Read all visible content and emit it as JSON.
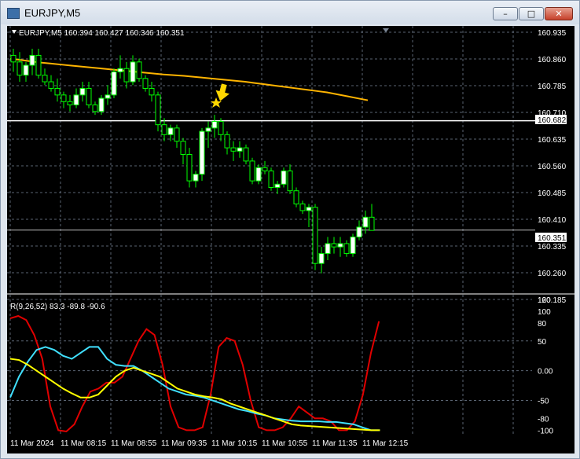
{
  "window": {
    "title": "EURJPY,M5",
    "minimize": "–",
    "maximize": "□",
    "close": "✕"
  },
  "chart_header": "EURJPY,M5  160.394 160.427 160.346 160.351",
  "indicator_header": "R(9,26,52) 83.3 -89.8 -90.6",
  "colors": {
    "bg": "#000000",
    "bull": "#ffffff",
    "bear": "#000000",
    "wick": "#00ff00",
    "ma": "#ffb400",
    "red": "#e00000",
    "cyan": "#40e0ff",
    "yellow": "#ffff00",
    "arrow": "#ffd700"
  },
  "price_axis": [
    "160.935",
    "160.860",
    "160.785",
    "160.710",
    "160.635",
    "160.560",
    "160.485",
    "160.410",
    "160.335",
    "160.260",
    "160.185"
  ],
  "price_tags": [
    "160.682",
    "160.351"
  ],
  "indicator_axis": [
    "120",
    "100",
    "80",
    "50",
    "0.00",
    "-50",
    "-80",
    "-100"
  ],
  "time_axis": [
    "11 Mar 2024",
    "11 Mar 08:15",
    "11 Mar 08:55",
    "11 Mar 09:35",
    "11 Mar 10:15",
    "11 Mar 10:55",
    "11 Mar 11:35",
    "11 Mar 12:15"
  ],
  "chart_data": {
    "type": "candlestick",
    "symbol": "EURJPY",
    "timeframe": "M5",
    "ylim": [
      160.16,
      160.95
    ],
    "horizontal_lines": [
      160.682,
      160.351
    ],
    "candles": [
      [
        160.88,
        160.9,
        160.83,
        160.86
      ],
      [
        160.86,
        160.89,
        160.8,
        160.82
      ],
      [
        160.82,
        160.86,
        160.8,
        160.85
      ],
      [
        160.85,
        160.9,
        160.82,
        160.88
      ],
      [
        160.88,
        160.9,
        160.81,
        160.82
      ],
      [
        160.82,
        160.84,
        160.79,
        160.8
      ],
      [
        160.8,
        160.82,
        160.77,
        160.78
      ],
      [
        160.78,
        160.81,
        160.74,
        160.76
      ],
      [
        160.76,
        160.77,
        160.72,
        160.74
      ],
      [
        160.74,
        160.76,
        160.71,
        160.73
      ],
      [
        160.73,
        160.78,
        160.72,
        160.76
      ],
      [
        160.76,
        160.8,
        160.74,
        160.78
      ],
      [
        160.78,
        160.8,
        160.72,
        160.73
      ],
      [
        160.73,
        160.74,
        160.7,
        160.71
      ],
      [
        160.71,
        160.76,
        160.7,
        160.75
      ],
      [
        160.75,
        160.79,
        160.73,
        160.76
      ],
      [
        160.76,
        160.84,
        160.75,
        160.83
      ],
      [
        160.83,
        160.88,
        160.81,
        160.84
      ],
      [
        160.84,
        160.86,
        160.78,
        160.8
      ],
      [
        160.8,
        160.88,
        160.79,
        160.86
      ],
      [
        160.86,
        160.87,
        160.8,
        160.81
      ],
      [
        160.81,
        160.82,
        160.77,
        160.78
      ],
      [
        160.78,
        160.8,
        160.74,
        160.76
      ],
      [
        160.76,
        160.77,
        160.65,
        160.67
      ],
      [
        160.67,
        160.69,
        160.62,
        160.64
      ],
      [
        160.64,
        160.67,
        160.62,
        160.66
      ],
      [
        160.66,
        160.67,
        160.6,
        160.62
      ],
      [
        160.62,
        160.63,
        160.55,
        160.58
      ],
      [
        160.58,
        160.6,
        160.48,
        160.5
      ],
      [
        160.5,
        160.53,
        160.48,
        160.52
      ],
      [
        160.52,
        160.66,
        160.5,
        160.65
      ],
      [
        160.65,
        160.68,
        160.6,
        160.66
      ],
      [
        160.66,
        160.7,
        160.63,
        160.68
      ],
      [
        160.68,
        160.69,
        160.62,
        160.64
      ],
      [
        160.64,
        160.65,
        160.58,
        160.6
      ],
      [
        160.6,
        160.62,
        160.56,
        160.59
      ],
      [
        160.59,
        160.62,
        160.57,
        160.6
      ],
      [
        160.6,
        160.61,
        160.55,
        160.56
      ],
      [
        160.56,
        160.57,
        160.49,
        160.5
      ],
      [
        160.5,
        160.55,
        160.49,
        160.54
      ],
      [
        160.54,
        160.56,
        160.52,
        160.53
      ],
      [
        160.53,
        160.54,
        160.47,
        160.48
      ],
      [
        160.48,
        160.5,
        160.46,
        160.49
      ],
      [
        160.49,
        160.54,
        160.48,
        160.53
      ],
      [
        160.53,
        160.55,
        160.46,
        160.47
      ],
      [
        160.47,
        160.48,
        160.42,
        160.43
      ],
      [
        160.43,
        160.44,
        160.4,
        160.41
      ],
      [
        160.41,
        160.43,
        160.36,
        160.42
      ],
      [
        160.42,
        160.43,
        160.23,
        160.25
      ],
      [
        160.25,
        160.3,
        160.22,
        160.28
      ],
      [
        160.28,
        160.33,
        160.26,
        160.31
      ],
      [
        160.31,
        160.33,
        160.28,
        160.3
      ],
      [
        160.3,
        160.33,
        160.27,
        160.31
      ],
      [
        160.31,
        160.32,
        160.27,
        160.28
      ],
      [
        160.28,
        160.34,
        160.27,
        160.33
      ],
      [
        160.33,
        160.38,
        160.32,
        160.36
      ],
      [
        160.36,
        160.41,
        160.34,
        160.39
      ],
      [
        160.39,
        160.43,
        160.35,
        160.35
      ]
    ],
    "moving_average": [
      160.87,
      160.866,
      160.862,
      160.858,
      160.855,
      160.852,
      160.849,
      160.846,
      160.843,
      160.84,
      160.837,
      160.834,
      160.831,
      160.828,
      160.825,
      160.822,
      160.82,
      160.818,
      160.815,
      160.812,
      160.809,
      160.806,
      160.803,
      160.8,
      160.796,
      160.792,
      160.788,
      160.784,
      160.78,
      160.776,
      160.772,
      160.768,
      160.762,
      160.756,
      160.75,
      160.744
    ],
    "indicator": {
      "ylim": [
        -110,
        125
      ],
      "red": [
        88,
        92,
        85,
        60,
        20,
        -60,
        -100,
        -102,
        -90,
        -60,
        -35,
        -30,
        -20,
        -20,
        -10,
        20,
        50,
        70,
        60,
        10,
        -60,
        -95,
        -100,
        -100,
        -95,
        -40,
        40,
        55,
        50,
        10,
        -50,
        -95,
        -100,
        -100,
        -95,
        -80,
        -60,
        -70,
        -80,
        -80,
        -85,
        -100,
        -100,
        -85,
        -40,
        30,
        83
      ],
      "cyan": [
        -45,
        -10,
        15,
        35,
        40,
        35,
        25,
        20,
        30,
        40,
        40,
        20,
        10,
        8,
        8,
        0,
        -10,
        -20,
        -30,
        -35,
        -40,
        -42,
        -45,
        -50,
        -55,
        -60,
        -65,
        -68,
        -72,
        -75,
        -80,
        -82,
        -84,
        -85,
        -85,
        -85,
        -86,
        -86,
        -88,
        -90,
        -95,
        -100,
        -100
      ],
      "yellow": [
        20,
        18,
        10,
        0,
        -10,
        -20,
        -30,
        -38,
        -45,
        -45,
        -40,
        -25,
        -10,
        0,
        5,
        0,
        -5,
        -10,
        -20,
        -30,
        -35,
        -40,
        -43,
        -45,
        -48,
        -55,
        -60,
        -65,
        -70,
        -75,
        -80,
        -85,
        -90,
        -92,
        -93,
        -94,
        -95,
        -96,
        -97,
        -98,
        -99,
        -100,
        -100
      ]
    }
  }
}
